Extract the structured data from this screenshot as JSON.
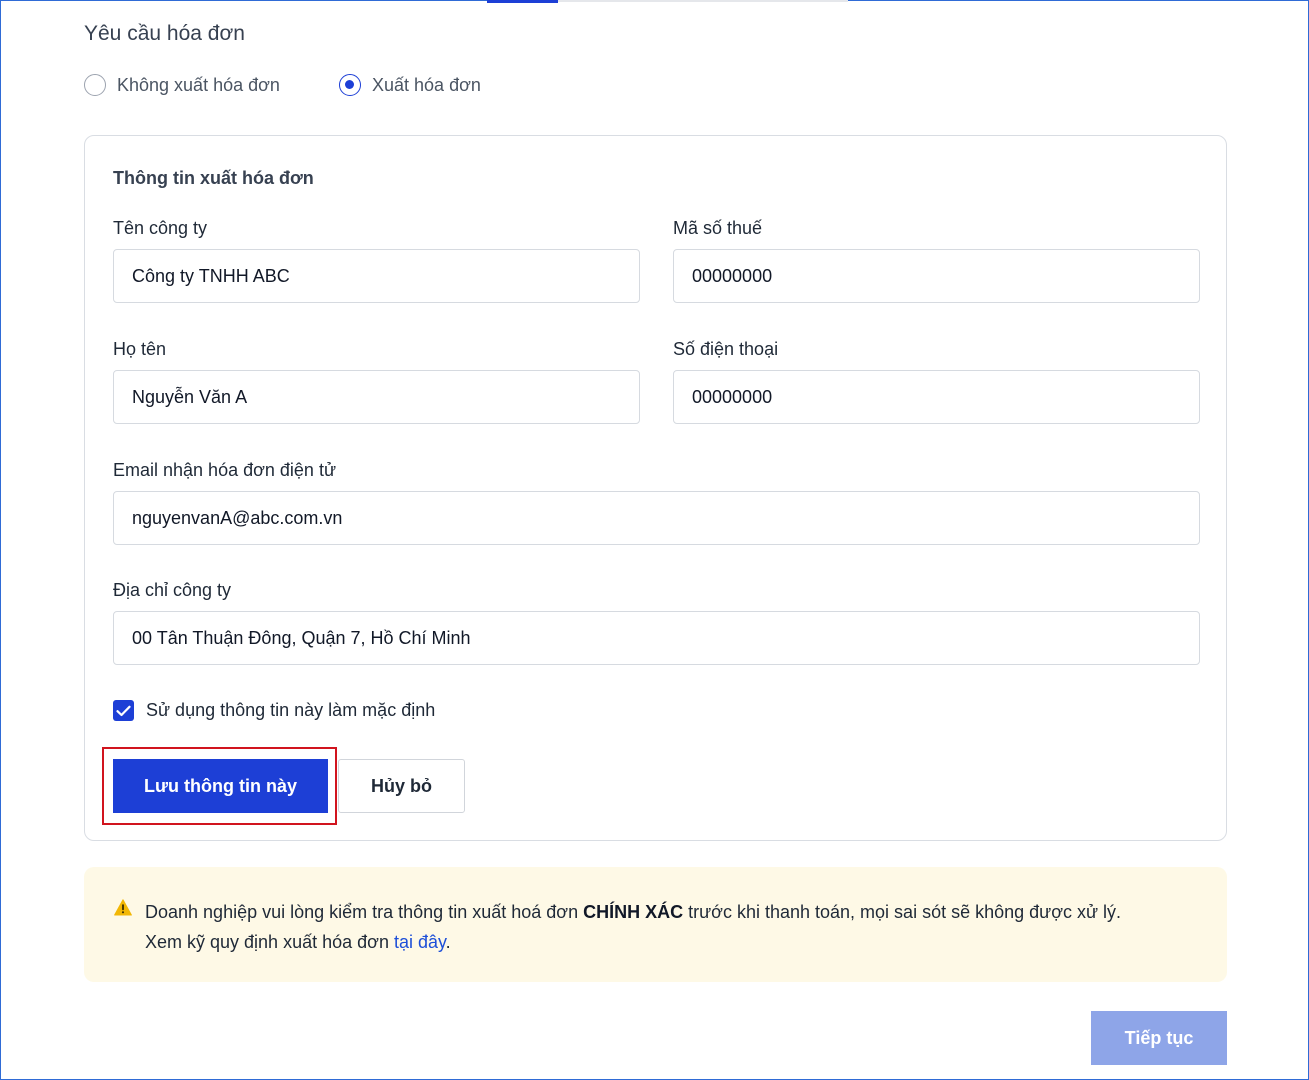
{
  "invoice_request": {
    "title": "Yêu cầu hóa đơn",
    "options": [
      {
        "label": "Không xuất hóa đơn",
        "selected": false
      },
      {
        "label": "Xuất hóa đơn",
        "selected": true
      }
    ]
  },
  "invoice_form": {
    "title": "Thông tin xuất hóa đơn",
    "company_name": {
      "label": "Tên công ty",
      "value": "Công ty TNHH ABC"
    },
    "tax_code": {
      "label": "Mã số thuế",
      "value": "00000000"
    },
    "full_name": {
      "label": "Họ tên",
      "value": "Nguyễn Văn A"
    },
    "phone": {
      "label": "Số điện thoại",
      "value": "00000000"
    },
    "email": {
      "label": "Email nhận hóa đơn điện tử",
      "value": "nguyenvanA@abc.com.vn"
    },
    "address": {
      "label": "Địa chỉ công ty",
      "value": "00 Tân Thuận Đông, Quận 7, Hồ Chí Minh"
    },
    "default_checkbox": {
      "label": "Sử dụng thông tin này làm mặc định",
      "checked": true
    },
    "save_label": "Lưu thông tin này",
    "cancel_label": "Hủy bỏ"
  },
  "notice": {
    "text_before": "Doanh nghiệp vui lòng kiểm tra thông tin xuất hoá đơn ",
    "emphasis": "CHÍNH XÁC",
    "text_after": " trước khi thanh toán, mọi sai sót sẽ không được xử lý.",
    "line2_before": "Xem kỹ quy định xuất hóa đơn ",
    "link_label": "tại đây",
    "line2_after": ".",
    "icon": "warning-icon"
  },
  "footer": {
    "continue_label": "Tiếp tục"
  },
  "colors": {
    "primary": "#1d3fd6",
    "highlight_border": "#d1141e",
    "notice_bg": "#fef9e6",
    "warning": "#f2b705",
    "continue_disabled": "#8ea5e8"
  }
}
